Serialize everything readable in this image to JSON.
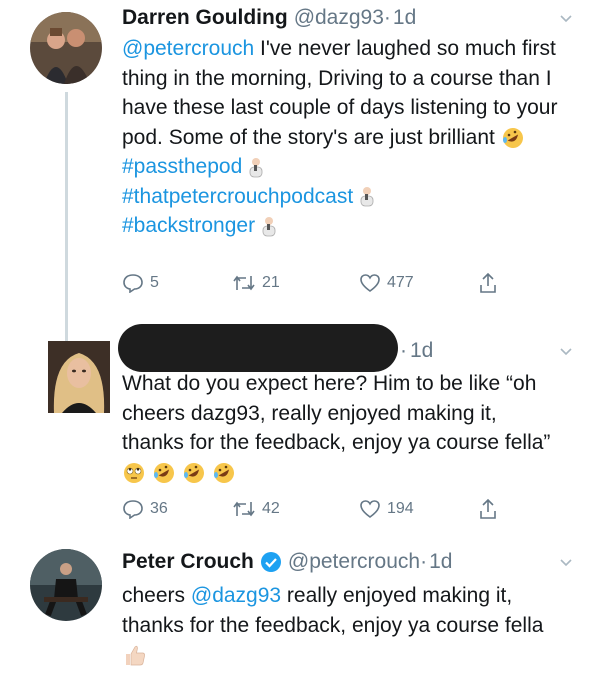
{
  "tweet1": {
    "name": "Darren Goulding",
    "handle": "@dazg93",
    "dot": "·",
    "time": "1d",
    "mention": "@petercrouch",
    "text": " I've never laughed so much first thing in the morning, Driving to a course than I have these last couple of days listening to your pod. Some of the story's are just brilliant",
    "hashtags": [
      "#passthepod",
      "#thatpetercrouchpodcast",
      "#backstronger"
    ],
    "replies": "5",
    "retweets": "21",
    "likes": "477"
  },
  "tweet2": {
    "time": "1d",
    "text": "What do you expect here? Him to be like “oh cheers dazg93, really enjoyed making it, thanks for the feedback, enjoy ya course fella”",
    "replies": "36",
    "retweets": "42",
    "likes": "194"
  },
  "tweet3": {
    "name": "Peter Crouch",
    "handle": "@petercrouch",
    "dot": "·",
    "time": "1d",
    "prefix": "cheers ",
    "mention": "@dazg93",
    "text": " really enjoyed making it, thanks for the feedback, enjoy ya course fella"
  },
  "icons": [
    "reply-icon",
    "retweet-icon",
    "like-icon",
    "share-icon",
    "verified-icon",
    "caret-down-icon"
  ],
  "colors": {
    "link": "#1b95e0",
    "secondary": "#657786",
    "verified": "#1da1f2",
    "line": "#cfd9de"
  }
}
